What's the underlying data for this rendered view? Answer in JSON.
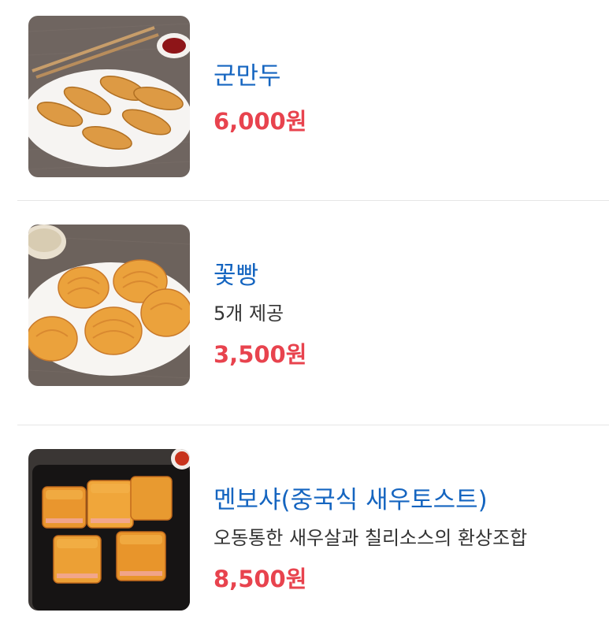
{
  "menu": {
    "items": [
      {
        "name": "군만두",
        "description": "",
        "price": "6,000원",
        "image_icon": "fried-dumplings-photo"
      },
      {
        "name": "꽃빵",
        "description": "5개 제공",
        "price": "3,500원",
        "image_icon": "flower-bun-photo"
      },
      {
        "name": "멘보샤(중국식 새우토스트)",
        "description": "오동통한 새우살과 칠리소스의 환상조합",
        "price": "8,500원",
        "image_icon": "shrimp-toast-photo"
      }
    ]
  },
  "colors": {
    "name": "#1565c0",
    "price": "#e8434e",
    "description": "#333333",
    "divider": "#e6e6e6"
  }
}
